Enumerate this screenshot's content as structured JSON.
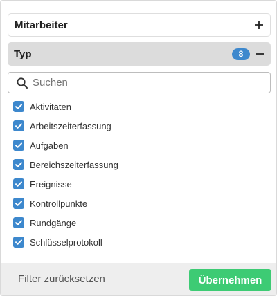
{
  "sections": {
    "employees": {
      "title": "Mitarbeiter",
      "icon": "plus-icon"
    },
    "type": {
      "title": "Typ",
      "count": "8",
      "icon": "minus-icon"
    }
  },
  "search": {
    "placeholder": "Suchen",
    "value": "",
    "icon": "search-icon"
  },
  "items": [
    {
      "label": "Aktivitäten",
      "checked": true
    },
    {
      "label": "Arbeitszeiterfassung",
      "checked": true
    },
    {
      "label": "Aufgaben",
      "checked": true
    },
    {
      "label": "Bereichszeiterfassung",
      "checked": true
    },
    {
      "label": "Ereignisse",
      "checked": true
    },
    {
      "label": "Kontrollpunkte",
      "checked": true
    },
    {
      "label": "Rundgänge",
      "checked": true
    },
    {
      "label": "Schlüsselprotokoll",
      "checked": true
    }
  ],
  "footer": {
    "reset_label": "Filter zurücksetzen",
    "apply_label": "Übernehmen"
  },
  "colors": {
    "accent": "#3d88cd",
    "apply": "#3dcb74",
    "header_active": "#dcdcdc"
  }
}
